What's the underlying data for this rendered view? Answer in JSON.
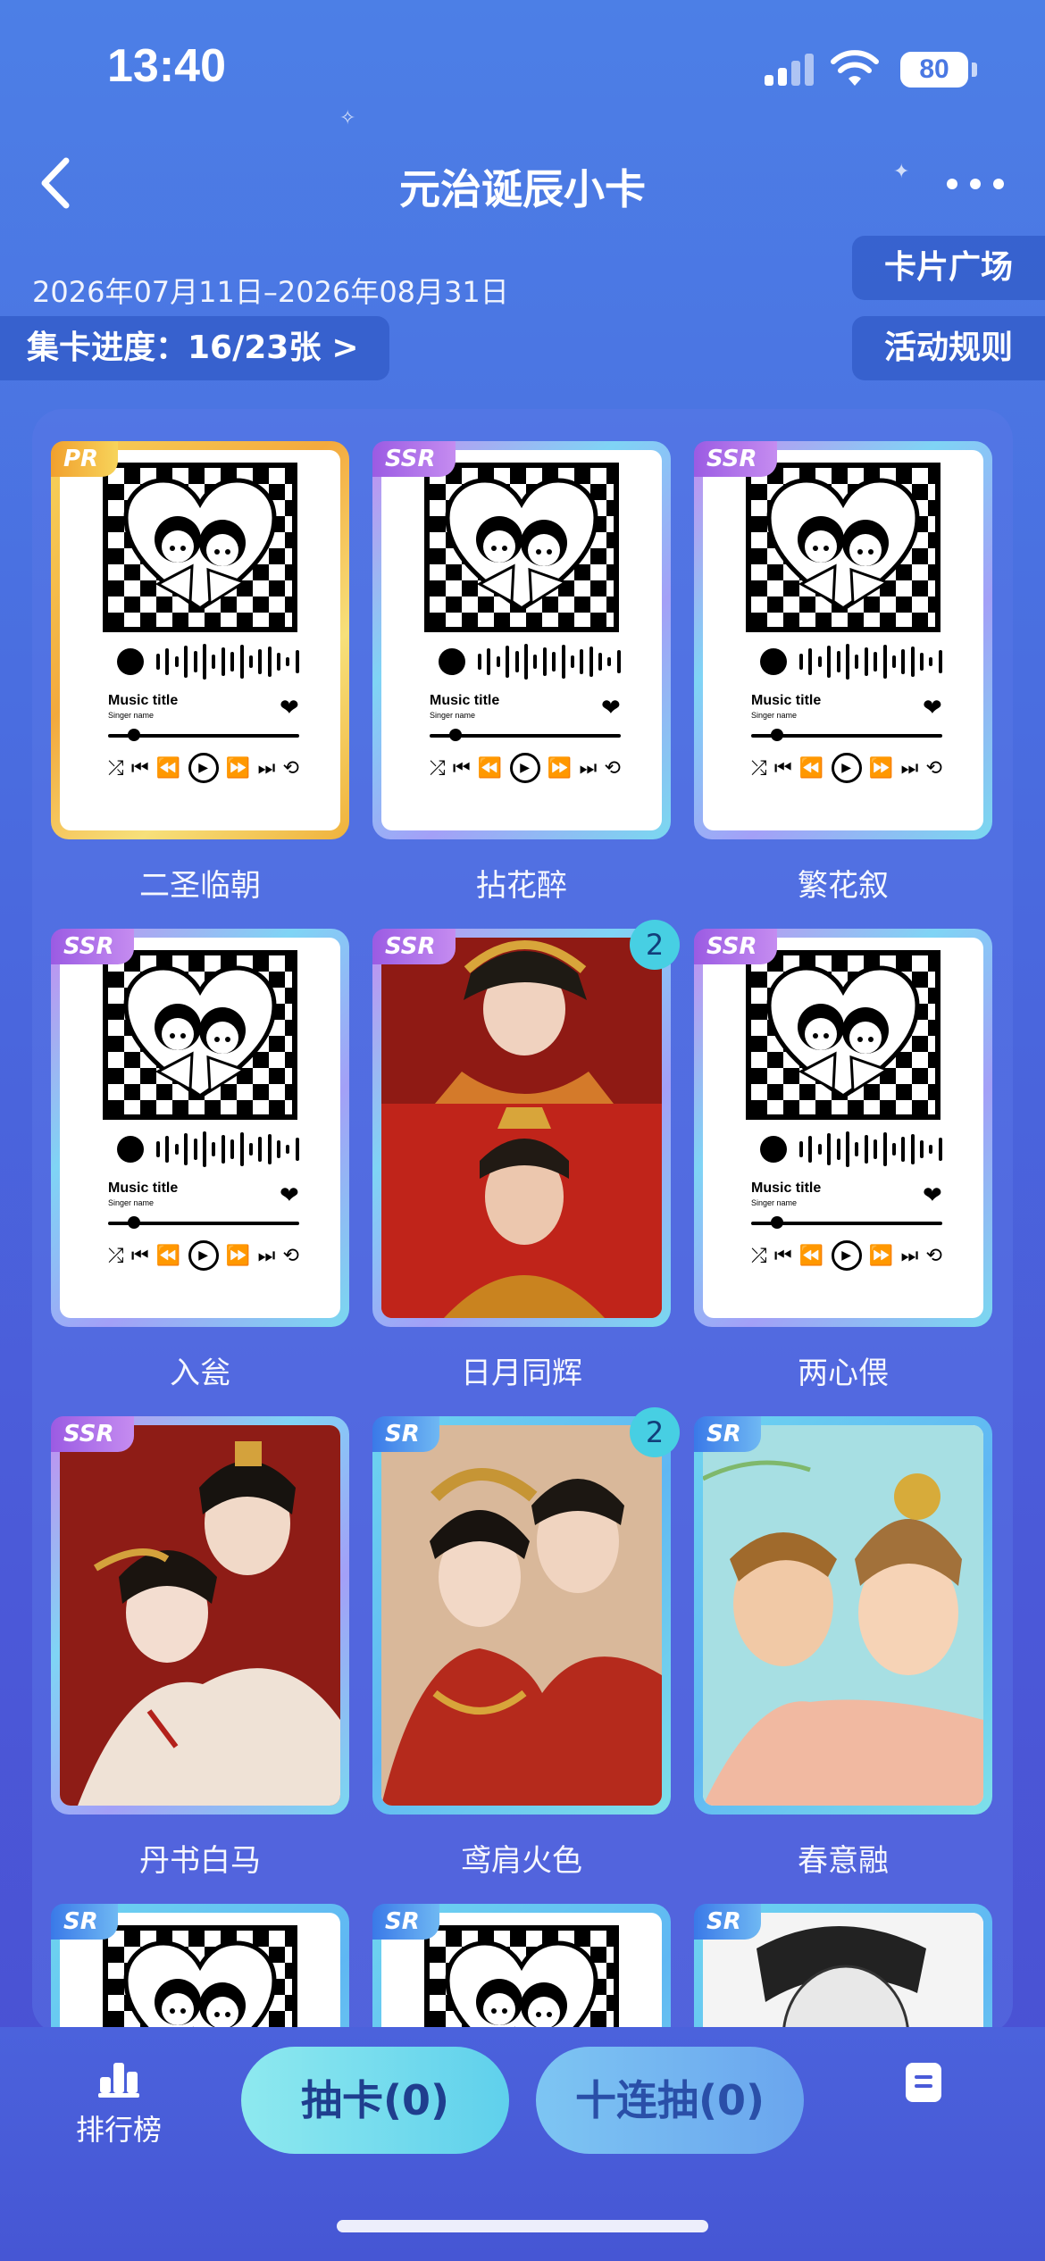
{
  "status_bar": {
    "time": "13:40",
    "battery": "80"
  },
  "header": {
    "title": "元治诞辰小卡",
    "date_range": "2026年07月11日–2026年08月31日",
    "progress": "集卡进度：16/23张",
    "progress_chevron": ">",
    "card_plaza": "卡片广场",
    "rules": "活动规则"
  },
  "music_card": {
    "title": "Music title",
    "singer": "Singer name"
  },
  "cards": [
    {
      "name": "二圣临朝",
      "rarity": "PR",
      "badge": null,
      "art": "music"
    },
    {
      "name": "拈花醉",
      "rarity": "SSR",
      "badge": null,
      "art": "music"
    },
    {
      "name": "繁花叙",
      "rarity": "SSR",
      "badge": null,
      "art": "music"
    },
    {
      "name": "入瓮",
      "rarity": "SSR",
      "badge": null,
      "art": "music"
    },
    {
      "name": "日月同辉",
      "rarity": "SSR",
      "badge": "2",
      "art": "painting-red-duo"
    },
    {
      "name": "两心偎",
      "rarity": "SSR",
      "badge": null,
      "art": "music"
    },
    {
      "name": "丹书白马",
      "rarity": "SSR",
      "badge": null,
      "art": "painting-embrace"
    },
    {
      "name": "鸢肩火色",
      "rarity": "SR",
      "badge": "2",
      "art": "painting-couple"
    },
    {
      "name": "春意融",
      "rarity": "SR",
      "badge": null,
      "art": "painting-spring"
    },
    {
      "name": "",
      "rarity": "SR",
      "badge": null,
      "art": "music"
    },
    {
      "name": "",
      "rarity": "SR",
      "badge": null,
      "art": "music"
    },
    {
      "name": "",
      "rarity": "SR",
      "badge": null,
      "art": "painting-sketch"
    }
  ],
  "bottom_bar": {
    "ranking": "排行榜",
    "draw": "抽卡(0)",
    "draw_ten": "十连抽(0)"
  },
  "colors": {
    "accent": "#5fd0ec",
    "badge": "#47cfe3",
    "pr_gold": "#f3a93d",
    "ssr_purple": "#9b5be3"
  }
}
